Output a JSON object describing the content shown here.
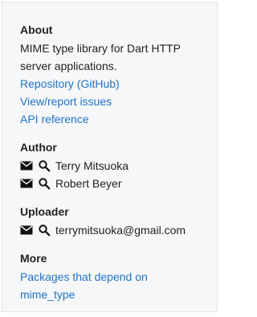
{
  "about": {
    "title": "About",
    "description": "MIME type library for Dart HTTP server applications.",
    "links": [
      "Repository (GitHub)",
      "View/report issues",
      "API reference"
    ]
  },
  "author": {
    "title": "Author",
    "people": [
      {
        "name": "Terry Mitsuoka"
      },
      {
        "name": "Robert Beyer"
      }
    ]
  },
  "uploader": {
    "title": "Uploader",
    "email": "terrymitsuoka@gmail.com"
  },
  "more": {
    "title": "More",
    "link": "Packages that depend on mime_type"
  },
  "colors": {
    "link": "#1f73c9",
    "text": "#222222",
    "panel_bg": "#f6f7f8",
    "panel_border": "#e2e2e2"
  },
  "icons": {
    "mail": "mail-icon",
    "search": "search-icon"
  }
}
